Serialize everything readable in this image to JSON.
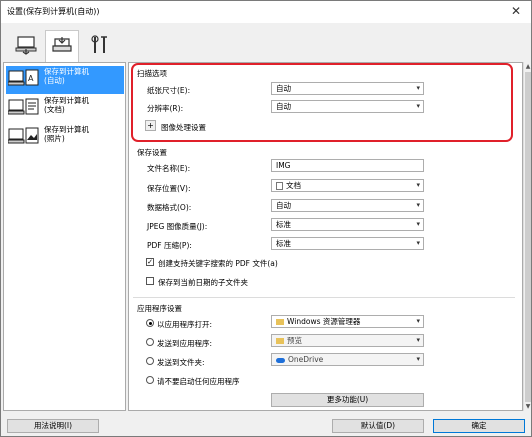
{
  "window": {
    "title": "设置(保存到计算机(自动))",
    "close_glyph": "✕"
  },
  "tabs": [
    {
      "name": "scan-from-computer"
    },
    {
      "name": "scan-from-panel"
    },
    {
      "name": "general-settings"
    }
  ],
  "sidebar": {
    "items": [
      {
        "label1": "保存到计算机",
        "label2": "(自动)"
      },
      {
        "label1": "保存到计算机",
        "label2": "(文档)"
      },
      {
        "label1": "保存到计算机",
        "label2": "(照片)"
      }
    ]
  },
  "scan_options": {
    "title": "扫描选项",
    "paper_size_label": "纸张尺寸(E):",
    "paper_size_value": "自动",
    "resolution_label": "分辨率(R):",
    "resolution_value": "自动",
    "image_processing_label": "图像处理设置",
    "plus_glyph": "+"
  },
  "save_settings": {
    "title": "保存设置",
    "file_name_label": "文件名称(E):",
    "file_name_value": "IMG",
    "save_in_label": "保存位置(V):",
    "save_in_value": "文档",
    "data_format_label": "数据格式(O):",
    "data_format_value": "自动",
    "jpeg_quality_label": "JPEG 图像质量(J):",
    "jpeg_quality_value": "标准",
    "pdf_compression_label": "PDF 压缩(P):",
    "pdf_compression_value": "标准",
    "create_pdf_label": "创建支持关键字搜索的 PDF 文件(a)",
    "create_pdf_checked": true,
    "save_subfolder_label": "保存到当前日期的子文件夹",
    "save_subfolder_checked": false
  },
  "app_settings": {
    "title": "应用程序设置",
    "open_with_label": "以应用程序打开:",
    "open_with_value": "Windows 资源管理器",
    "send_to_app_label": "发送到应用程序:",
    "send_to_app_value": "预览",
    "send_to_folder_label": "发送到文件夹:",
    "send_to_folder_value": "OneDrive",
    "no_app_label": "请不要启动任何应用程序",
    "more_functions_label": "更多功能(U)",
    "selected_option": "open_with"
  },
  "footer": {
    "instructions_label": "用法说明(I)",
    "defaults_label": "默认值(D)",
    "ok_label": "确定"
  },
  "colors": {
    "highlight": "#e0202a",
    "selection": "#3399ff"
  }
}
